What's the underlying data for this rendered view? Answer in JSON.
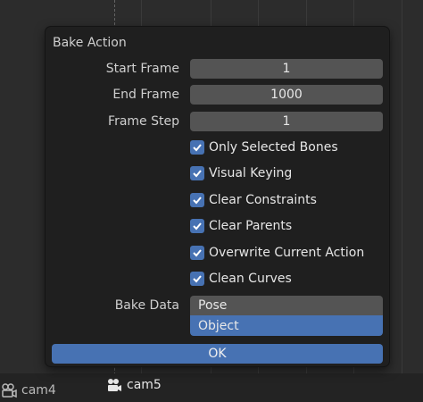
{
  "dialog": {
    "title": "Bake Action",
    "start_frame": {
      "label": "Start Frame",
      "value": "1"
    },
    "end_frame": {
      "label": "End Frame",
      "value": "1000"
    },
    "frame_step": {
      "label": "Frame Step",
      "value": "1"
    },
    "options": [
      {
        "label": "Only Selected Bones",
        "checked": true
      },
      {
        "label": "Visual Keying",
        "checked": true
      },
      {
        "label": "Clear Constraints",
        "checked": true
      },
      {
        "label": "Clear Parents",
        "checked": true
      },
      {
        "label": "Overwrite Current Action",
        "checked": true
      },
      {
        "label": "Clean Curves",
        "checked": true
      }
    ],
    "bake_data": {
      "label": "Bake Data",
      "options": [
        "Pose",
        "Object"
      ],
      "highlighted": "Object"
    },
    "ok_label": "OK"
  },
  "timeline": {
    "markers": [
      "cam4",
      "cam5"
    ]
  },
  "colors": {
    "accent": "#4772b3",
    "dialog_bg": "#1f1f1f",
    "field_bg": "#545454"
  }
}
